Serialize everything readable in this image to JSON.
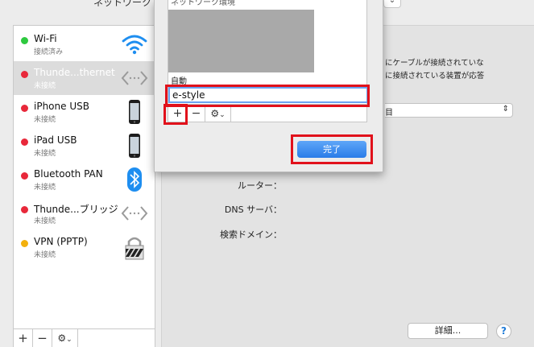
{
  "header": {
    "label": "ネットワーク"
  },
  "sidebar": {
    "services": [
      {
        "name": "Wi-Fi",
        "status": "接続済み",
        "dot": "#2ec93f",
        "icon": "wifi-icon"
      },
      {
        "name": "Thunde...thernet",
        "status": "未接続",
        "dot": "#e8283a",
        "icon": "ethernet-arrows-icon"
      },
      {
        "name": "iPhone USB",
        "status": "未接続",
        "dot": "#e8283a",
        "icon": "iphone-icon"
      },
      {
        "name": "iPad USB",
        "status": "未接続",
        "dot": "#e8283a",
        "icon": "iphone-icon"
      },
      {
        "name": "Bluetooth PAN",
        "status": "未接続",
        "dot": "#e8283a",
        "icon": "bluetooth-icon"
      },
      {
        "name": "Thunde...ブリッジ",
        "status": "未接続",
        "dot": "#e8283a",
        "icon": "bridge-arrows-icon"
      },
      {
        "name": "VPN (PPTP)",
        "status": "未接続",
        "dot": "#f3b10d",
        "icon": "vpn-lock-icon"
      }
    ],
    "add": "+",
    "remove": "−",
    "gear": "⚙",
    "chevron": "⌄"
  },
  "dialog": {
    "list_header": "ネットワーク環境",
    "auto_item": "自動",
    "new_location": "e-style",
    "add": "+",
    "remove": "−",
    "gear": "⚙",
    "chevron": "⌄",
    "done": "完了"
  },
  "details": {
    "info_line1": "にケーブルが接続されていな",
    "info_line2": "に接続されている装置が応答",
    "select_fragment": "目",
    "router_label": "ルーター：",
    "dns_label": "DNS サーバ：",
    "search_domain_label": "検索ドメイン：",
    "advanced_button": "詳細...",
    "help_button": "?"
  },
  "colors": {
    "highlight": "#e1111b",
    "selected_row": "#dcdcdc",
    "done_button": "#2a7ce8"
  }
}
